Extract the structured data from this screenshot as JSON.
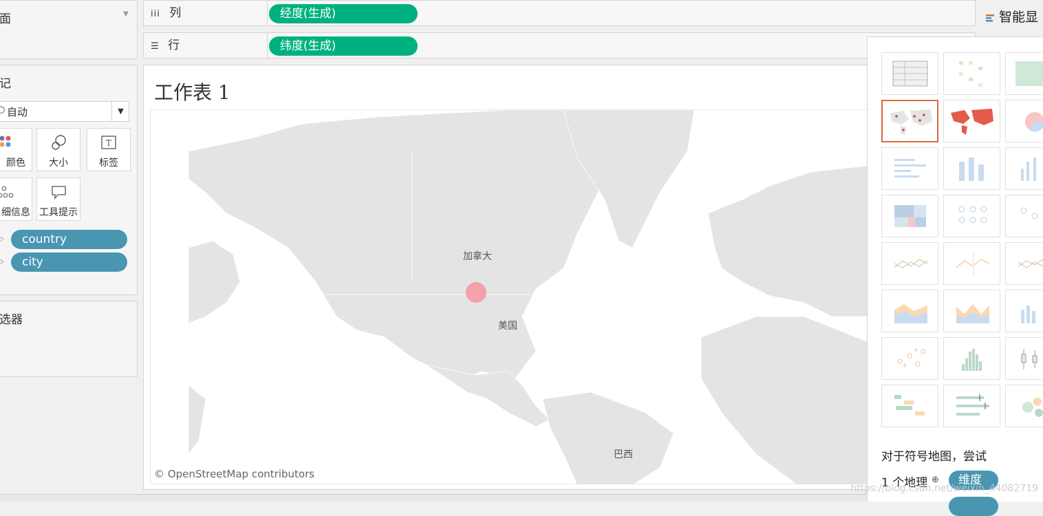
{
  "pages_panel": {
    "title": "面"
  },
  "marks_panel": {
    "title": "记",
    "mark_type": "自动",
    "buttons": [
      {
        "label": "颜色",
        "icon": "color-icon"
      },
      {
        "label": "大小",
        "icon": "size-icon"
      },
      {
        "label": "标签",
        "icon": "label-icon"
      },
      {
        "label": "细信息",
        "icon": "detail-icon"
      },
      {
        "label": "工具提示",
        "icon": "tooltip-icon"
      }
    ],
    "fields": [
      "country",
      "city"
    ]
  },
  "filters_panel": {
    "title": "选器"
  },
  "shelves": {
    "columns": {
      "label": "列",
      "pill": "经度(生成)"
    },
    "rows": {
      "label": "行",
      "pill": "纬度(生成)"
    }
  },
  "sheet": {
    "title": "工作表 1"
  },
  "map": {
    "labels": {
      "canada": "加拿大",
      "usa": "美国",
      "brazil": "巴西"
    },
    "attribution": "© OpenStreetMap contributors",
    "mark_color": "#f4a1a8"
  },
  "show_me": {
    "title": "智能显",
    "hint_line1": "对于符号地图，尝试",
    "hint_line2_prefix": "1 个地理",
    "hint_pill": "维度",
    "selected_color": "#d96a3c"
  },
  "watermark": "https://blog.csdn.net/weixin_44082719"
}
